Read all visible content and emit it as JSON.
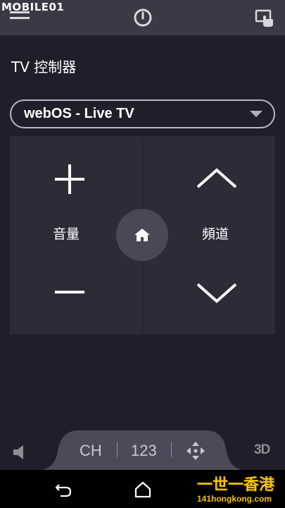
{
  "watermark": {
    "text": "MOBILE01"
  },
  "header": {
    "menu_icon": "hamburger-icon",
    "power_icon": "power-icon",
    "screen_touch_icon": "screen-touch-icon"
  },
  "title": "TV 控制器",
  "source": {
    "selected": "webOS - Live TV"
  },
  "volume": {
    "label": "音量",
    "up_icon": "plus-icon",
    "down_icon": "minus-icon"
  },
  "channel": {
    "label": "頻道",
    "up_icon": "chevron-up-icon",
    "down_icon": "chevron-down-icon"
  },
  "home": {
    "icon": "home-icon"
  },
  "bottom_bar": {
    "tab_ch": "CH",
    "tab_numbers": "123",
    "move_icon": "move-icon",
    "mute_icon": "speaker-icon",
    "three_d": "3D"
  },
  "nav": {
    "back_icon": "back-icon",
    "home_icon": "home-nav-icon"
  },
  "corner_watermark": {
    "cn": "一世一香港",
    "url": "141hongkong.com"
  },
  "colors": {
    "background": "#1f1f2b",
    "topbar": "#3a3a47",
    "pad": "#2c2c39",
    "home_button": "#494857",
    "bottom_tab": "#4a4a59",
    "watermark_yellow": "#f5c400"
  }
}
